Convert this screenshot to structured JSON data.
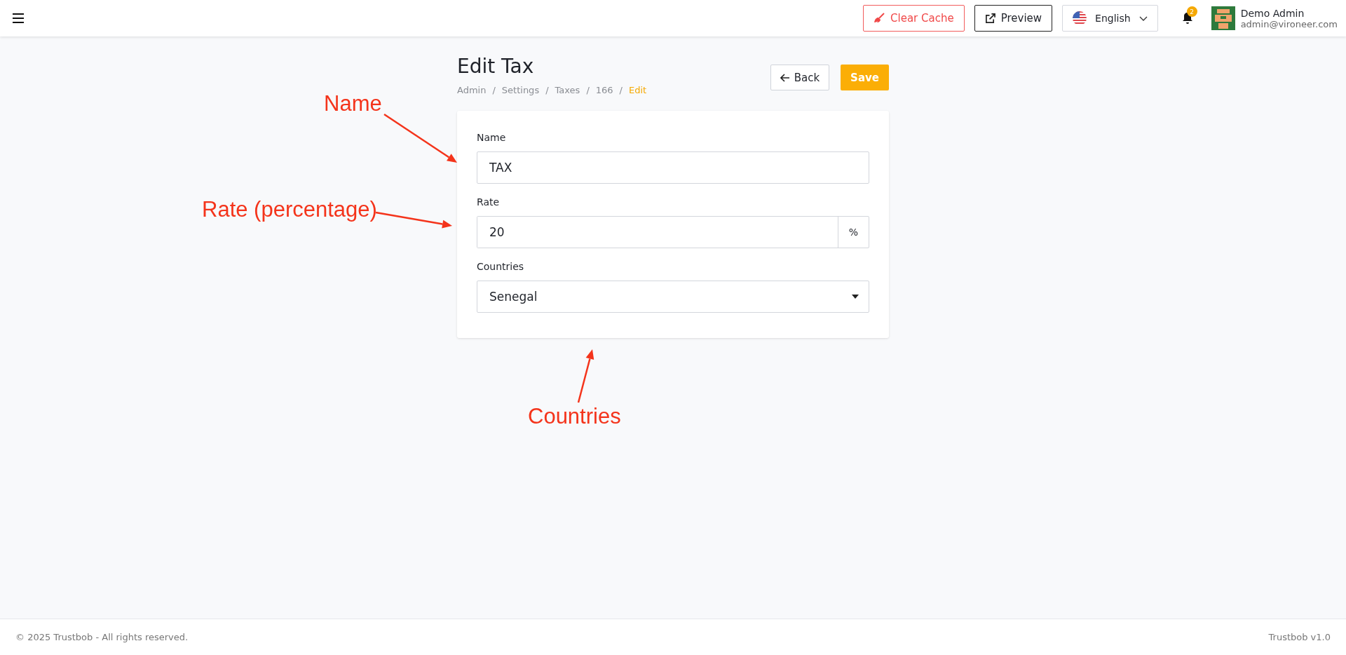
{
  "topbar": {
    "clear_cache": "Clear Cache",
    "preview": "Preview",
    "language": "English",
    "notification_count": "2",
    "user": {
      "name": "Demo Admin",
      "email": "admin@vironeer.com"
    }
  },
  "page": {
    "title": "Edit Tax",
    "breadcrumb_separator": "/",
    "breadcrumbs": [
      {
        "label": "Admin",
        "current": false
      },
      {
        "label": "Settings",
        "current": false
      },
      {
        "label": "Taxes",
        "current": false
      },
      {
        "label": "166",
        "current": false
      },
      {
        "label": "Edit",
        "current": true
      }
    ],
    "back": "Back",
    "save": "Save"
  },
  "form": {
    "fields": [
      {
        "kind": "text",
        "label": "Name",
        "value": "TAX"
      },
      {
        "kind": "addon",
        "label": "Rate",
        "value": "20",
        "addon": "%"
      },
      {
        "kind": "select",
        "label": "Countries",
        "value": "Senegal"
      }
    ]
  },
  "annotations": [
    "Name",
    "Rate (percentage)",
    "Countries"
  ],
  "footer": {
    "copyright": "© 2025 Trustbob - All rights reserved.",
    "version": "Trustbob v1.0"
  }
}
